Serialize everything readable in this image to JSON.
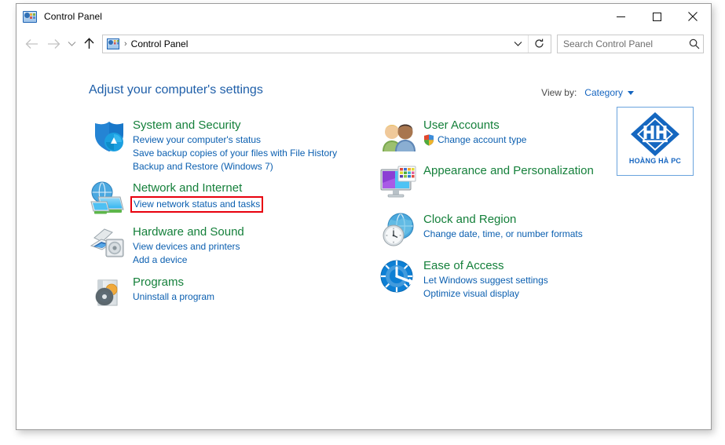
{
  "window": {
    "title": "Control Panel",
    "icon": "control-panel-icon",
    "buttons": {
      "minimize": "Minimize",
      "maximize": "Maximize",
      "close": "Close"
    }
  },
  "navbar": {
    "back": "Back",
    "forward": "Forward",
    "recent": "Recent locations",
    "up": "Up one level",
    "breadcrumb_separator": "›",
    "breadcrumb": "Control Panel",
    "address_dropdown": "Previous locations",
    "refresh": "Refresh Control Panel",
    "search": {
      "value": "",
      "placeholder": "Search Control Panel"
    }
  },
  "main": {
    "page_title": "Adjust your computer's settings",
    "view_by": {
      "label": "View by:",
      "value": "Category"
    }
  },
  "categories": {
    "left": [
      {
        "icon": "system-and-security-icon",
        "title": "System and Security",
        "links": [
          {
            "text": "Review your computer's status",
            "highlighted": false,
            "shield": false
          },
          {
            "text": "Save backup copies of your files with File History",
            "highlighted": false,
            "shield": false
          },
          {
            "text": "Backup and Restore (Windows 7)",
            "highlighted": false,
            "shield": false
          }
        ]
      },
      {
        "icon": "network-and-internet-icon",
        "title": "Network and Internet",
        "links": [
          {
            "text": "View network status and tasks",
            "highlighted": true,
            "shield": false
          }
        ]
      },
      {
        "icon": "hardware-and-sound-icon",
        "title": "Hardware and Sound",
        "links": [
          {
            "text": "View devices and printers",
            "highlighted": false,
            "shield": false
          },
          {
            "text": "Add a device",
            "highlighted": false,
            "shield": false
          }
        ]
      },
      {
        "icon": "programs-icon",
        "title": "Programs",
        "links": [
          {
            "text": "Uninstall a program",
            "highlighted": false,
            "shield": false
          }
        ]
      }
    ],
    "right": [
      {
        "icon": "user-accounts-icon",
        "title": "User Accounts",
        "links": [
          {
            "text": "Change account type",
            "highlighted": false,
            "shield": true
          }
        ]
      },
      {
        "icon": "appearance-and-personalization-icon",
        "title": "Appearance and Personalization",
        "links": []
      },
      {
        "icon": "clock-and-region-icon",
        "title": "Clock and Region",
        "links": [
          {
            "text": "Change date, time, or number formats",
            "highlighted": false,
            "shield": false
          }
        ]
      },
      {
        "icon": "ease-of-access-icon",
        "title": "Ease of Access",
        "links": [
          {
            "text": "Let Windows suggest settings",
            "highlighted": false,
            "shield": false
          },
          {
            "text": "Optimize visual display",
            "highlighted": false,
            "shield": false
          }
        ]
      }
    ]
  },
  "watermark": {
    "text": "HOÀNG HÀ PC",
    "mark": "hoang-ha-pc-diamond-logo"
  },
  "colors": {
    "category_title": "#15803b",
    "link": "#0b5fb0",
    "page_title": "#1f5fa9",
    "highlight": "#e8000d",
    "accent": "#1565c0"
  }
}
